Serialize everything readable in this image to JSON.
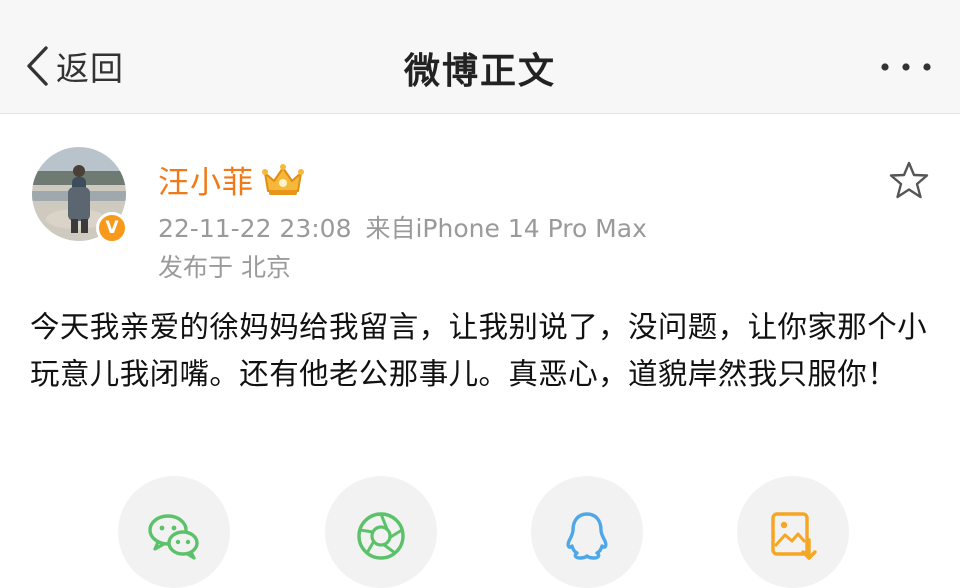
{
  "nav": {
    "back_label": "返回",
    "title": "微博正文"
  },
  "post": {
    "author": "汪小菲",
    "verified_badge": "V",
    "timestamp": "22-11-22 23:08",
    "source": "来自iPhone 14 Pro Max",
    "location_prefix": "发布于",
    "location": "北京",
    "content": "今天我亲爱的徐妈妈给我留言，让我别说了，没问题，让你家那个小玩意儿我闭嘴。还有他老公那事儿。真恶心，道貌岸然我只服你！"
  },
  "share_targets": [
    "wechat-icon",
    "moments-icon",
    "qq-icon",
    "save-image-icon"
  ],
  "colors": {
    "username": "#f07a1a",
    "meta": "#9a9a9a",
    "wechat": "#5cc26a",
    "qq": "#4ea7e6",
    "save": "#f5a623"
  }
}
